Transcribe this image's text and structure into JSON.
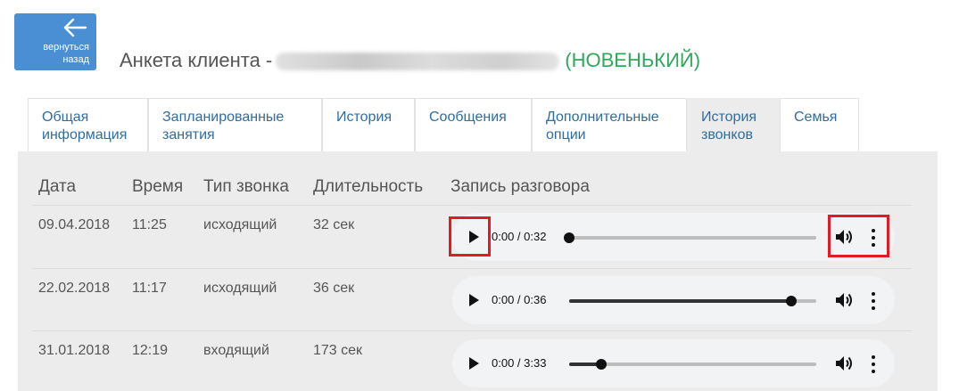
{
  "back_button": {
    "label_line1": "вернуться",
    "label_line2": "назад"
  },
  "header": {
    "title": "Анкета клиента -",
    "status": "(НОВЕНЬКИЙ)"
  },
  "tabs": [
    {
      "line1": "Общая",
      "line2": "информация"
    },
    {
      "line1": "Запланированные",
      "line2": "занятия"
    },
    {
      "line1": "История",
      "line2": ""
    },
    {
      "line1": "Сообщения",
      "line2": ""
    },
    {
      "line1": "Дополнительные",
      "line2": "опции"
    },
    {
      "line1": "История",
      "line2": "звонков"
    },
    {
      "line1": "Семья",
      "line2": ""
    }
  ],
  "active_tab": "История звонков",
  "table": {
    "headers": [
      "Дата",
      "Время",
      "Тип звонка",
      "Длительность",
      "Запись разговора"
    ],
    "rows": [
      {
        "date": "09.04.2018",
        "time": "11:25",
        "type": "исходящий",
        "duration": "32 сек",
        "player_time": "0:00 / 0:32",
        "progress": 0
      },
      {
        "date": "22.02.2018",
        "time": "11:17",
        "type": "исходящий",
        "duration": "36 сек",
        "player_time": "0:00 / 0:36",
        "progress": 0.9
      },
      {
        "date": "31.01.2018",
        "time": "12:19",
        "type": "входящий",
        "duration": "173 сек",
        "player_time": "0:00 / 3:33",
        "progress": 0.13
      }
    ]
  },
  "colors": {
    "accent": "#4a8fd4",
    "status": "#2fa85a",
    "tab_text": "#2e6da4",
    "highlight": "#e01b24"
  }
}
